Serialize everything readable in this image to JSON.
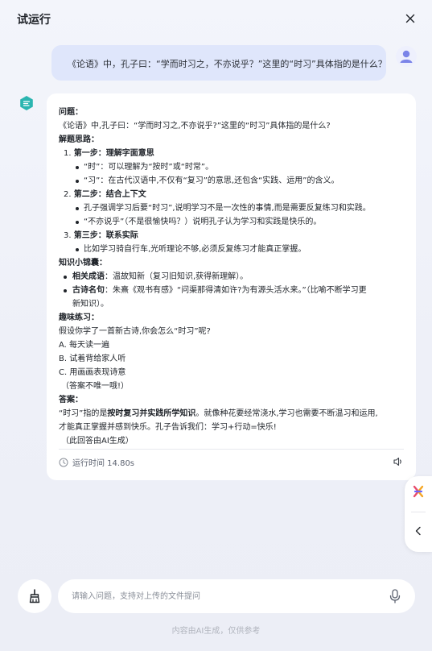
{
  "header": {
    "title": "试运行",
    "close_icon": "close-icon"
  },
  "user_message": {
    "text": "《论语》中，孔子曰：“学而时习之，不亦说乎？”这里的“时习”具体指的是什么？"
  },
  "answer": {
    "question_heading": "问题：",
    "question_text": "《论语》中,孔子曰：“学而时习之,不亦说乎?”这里的“时习”具体指的是什么?",
    "approach_heading": "解题思路：",
    "steps": [
      {
        "num": "1.",
        "title": "第一步：理解字面意思",
        "bullets": [
          "“时”：可以理解为“按时”或“时常”。",
          "“习”：在古代汉语中,不仅有“复习”的意思,还包含“实践、运用”的含义。"
        ]
      },
      {
        "num": "2.",
        "title": "第二步：结合上下文",
        "bullets": [
          "孔子强调学习后要“时习”,说明学习不是一次性的事情,而是需要反复练习和实践。",
          "“不亦说乎”（不是很愉快吗？）说明孔子认为学习和实践是快乐的。"
        ]
      },
      {
        "num": "3.",
        "title": "第三步：联系实际",
        "bullets": [
          "比如学习骑自行车,光听理论不够,必须反复练习才能真正掌握。"
        ]
      }
    ],
    "knowledge_heading": "知识小锦囊：",
    "knowledge": [
      {
        "label": "相关成语",
        "text": "：温故知新（复习旧知识,获得新理解）。"
      },
      {
        "label": "古诗名句",
        "text": "：朱熹《观书有感》“问渠那得清如许?为有源头活水来。”（比喻不断学习更",
        "cont": "新知识）。"
      }
    ],
    "practice_heading": "趣味练习：",
    "practice_question": "假设你学了一首新古诗,你会怎么“时习”呢?",
    "options": [
      "A. 每天读一遍",
      "B. 试着背给家人听",
      "C. 用画画表现诗意"
    ],
    "practice_note": "（答案不唯一哦!）",
    "answer_heading": "答案：",
    "answer_pre": "“时习”指的是",
    "answer_bold": "按时复习并实践所学知识",
    "answer_post": "。就像种花要经常浇水,学习也需要不断温习和运用,",
    "answer_line2": "才能真正掌握并感到快乐。孔子告诉我们：学习+行动=快乐!",
    "ai_note": "（此回答由AI生成）"
  },
  "runtime": {
    "label": "运行时间 14.80s"
  },
  "input": {
    "placeholder": "请输入问题，支持对上传的文件提问"
  },
  "footer": {
    "disclaimer": "内容由AI生成，仅供参考"
  },
  "colors": {
    "user_bubble": "#dfe6fb",
    "bot_accent": "#2bb5b0",
    "background": "#f0f2f9"
  }
}
